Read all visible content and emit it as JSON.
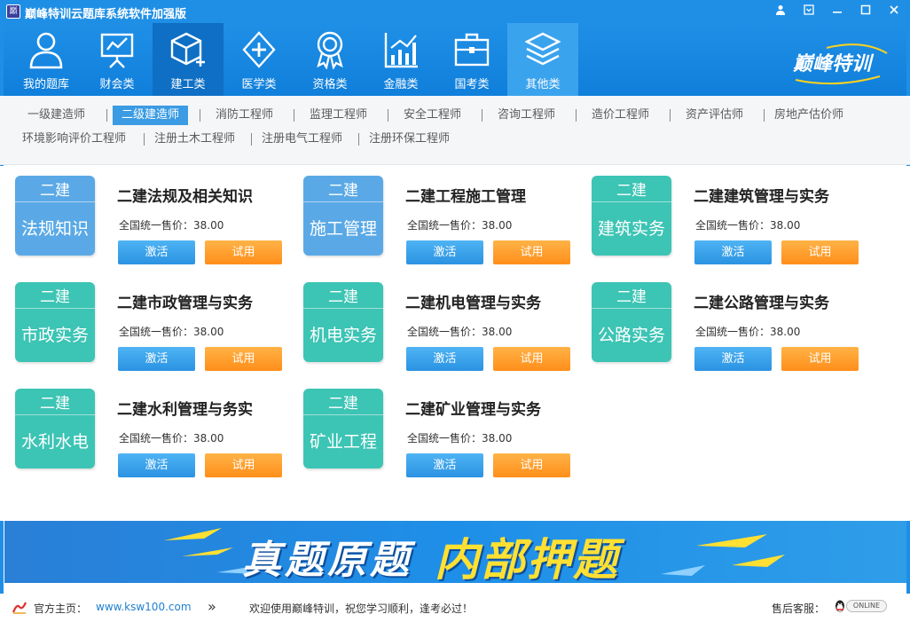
{
  "window": {
    "title": "巅峰特训云题库系统软件加强版",
    "app_icon": "巅"
  },
  "nav": {
    "items": [
      {
        "label": "我的题库",
        "icon": "user-icon"
      },
      {
        "label": "财会类",
        "icon": "chart-board-icon"
      },
      {
        "label": "建工类",
        "icon": "cube-icon"
      },
      {
        "label": "医学类",
        "icon": "medical-cross-icon"
      },
      {
        "label": "资格类",
        "icon": "award-badge-icon"
      },
      {
        "label": "金融类",
        "icon": "bar-chart-icon"
      },
      {
        "label": "国考类",
        "icon": "briefcase-icon"
      },
      {
        "label": "其他类",
        "icon": "layers-icon"
      }
    ],
    "active_index": 2,
    "brand": "巅峰特训"
  },
  "subcategories": {
    "row1": [
      "一级建造师",
      "二级建造师",
      "消防工程师",
      "监理工程师",
      "安全工程师",
      "咨询工程师",
      "造价工程师",
      "资产评估师",
      "房地产估价师"
    ],
    "row2": [
      "环境影响评价工程师",
      "注册土木工程师",
      "注册电气工程师",
      "注册环保工程师"
    ],
    "active": "二级建造师"
  },
  "products": [
    {
      "tile_top": "二建",
      "tile_bottom": "法规知识",
      "title": "二建法规及相关知识",
      "price": "全国统一售价：38.00",
      "color": "#5aa9e6",
      "activate": "激活",
      "trial": "试用"
    },
    {
      "tile_top": "二建",
      "tile_bottom": "施工管理",
      "title": "二建工程施工管理",
      "price": "全国统一售价：38.00",
      "color": "#5aa9e6",
      "activate": "激活",
      "trial": "试用"
    },
    {
      "tile_top": "二建",
      "tile_bottom": "建筑实务",
      "title": "二建建筑管理与实务",
      "price": "全国统一售价：38.00",
      "color": "#3cc4b4",
      "activate": "激活",
      "trial": "试用"
    },
    {
      "tile_top": "二建",
      "tile_bottom": "市政实务",
      "title": "二建市政管理与实务",
      "price": "全国统一售价：38.00",
      "color": "#3cc4b4",
      "activate": "激活",
      "trial": "试用"
    },
    {
      "tile_top": "二建",
      "tile_bottom": "机电实务",
      "title": "二建机电管理与实务",
      "price": "全国统一售价：38.00",
      "color": "#3cc4b4",
      "activate": "激活",
      "trial": "试用"
    },
    {
      "tile_top": "二建",
      "tile_bottom": "公路实务",
      "title": "二建公路管理与实务",
      "price": "全国统一售价：38.00",
      "color": "#3cc4b4",
      "activate": "激活",
      "trial": "试用"
    },
    {
      "tile_top": "二建",
      "tile_bottom": "水利水电",
      "title": "二建水利管理与务实",
      "price": "全国统一售价：38.00",
      "color": "#3cc4b4",
      "activate": "激活",
      "trial": "试用"
    },
    {
      "tile_top": "二建",
      "tile_bottom": "矿业工程",
      "title": "二建矿业管理与实务",
      "price": "全国统一售价：38.00",
      "color": "#3cc4b4",
      "activate": "激活",
      "trial": "试用"
    }
  ],
  "banner": {
    "text1": "真题原题",
    "text2": "内部押题"
  },
  "status": {
    "homepage_label": "官方主页：",
    "homepage_url": "www.ksw100.com",
    "arrows": "»",
    "welcome": "欢迎使用巅峰特训，祝您学习顺利，逢考必过！",
    "service_label": "售后客服：",
    "online": "ONLINE"
  }
}
